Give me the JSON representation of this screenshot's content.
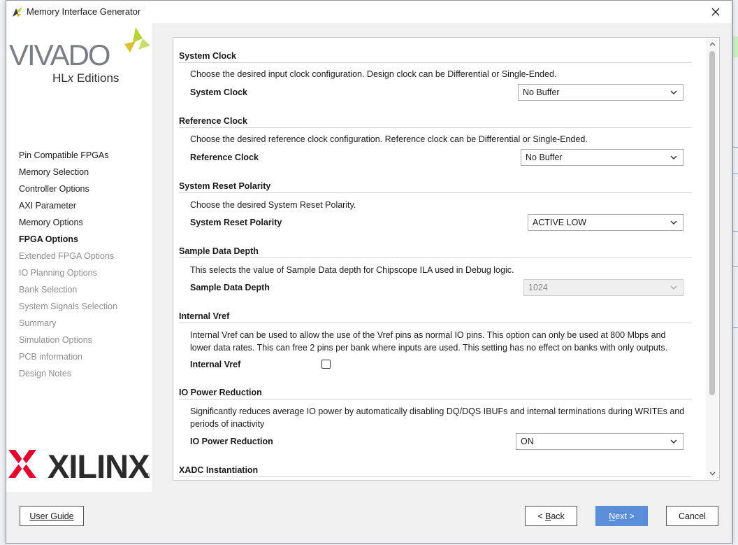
{
  "window": {
    "title": "Memory Interface Generator"
  },
  "branding": {
    "vivado": "VIVADO",
    "hlx_prefix": "HL",
    "hlx_x": "x",
    "hlx_suffix": " Editions",
    "xilinx": "XILINX",
    "reg": "®"
  },
  "nav": {
    "items": [
      {
        "label": "Pin Compatible FPGAs",
        "state": "normal"
      },
      {
        "label": "Memory Selection",
        "state": "normal"
      },
      {
        "label": "Controller Options",
        "state": "normal"
      },
      {
        "label": "AXI Parameter",
        "state": "normal"
      },
      {
        "label": "Memory Options",
        "state": "normal"
      },
      {
        "label": "FPGA Options",
        "state": "active"
      },
      {
        "label": "Extended FPGA Options",
        "state": "disabled"
      },
      {
        "label": "IO Planning Options",
        "state": "disabled"
      },
      {
        "label": "Bank Selection",
        "state": "disabled"
      },
      {
        "label": "System Signals Selection",
        "state": "disabled"
      },
      {
        "label": "Summary",
        "state": "disabled"
      },
      {
        "label": "Simulation Options",
        "state": "disabled"
      },
      {
        "label": "PCB information",
        "state": "disabled"
      },
      {
        "label": "Design Notes",
        "state": "disabled"
      }
    ]
  },
  "sections": {
    "system_clock": {
      "title": "System Clock",
      "desc": "Choose the desired input clock configuration. Design clock can be Differential or Single-Ended.",
      "label": "System Clock",
      "value": "No Buffer"
    },
    "reference_clock": {
      "title": "Reference Clock",
      "desc": "Choose the desired reference clock configuration. Reference clock can be Differential or Single-Ended.",
      "label": "Reference Clock",
      "value": "No Buffer"
    },
    "reset_polarity": {
      "title": "System Reset Polarity",
      "desc": "Choose the desired System Reset Polarity.",
      "label": "System Reset Polarity",
      "value": "ACTIVE LOW"
    },
    "sample_depth": {
      "title": "Sample Data Depth",
      "desc": "This selects the value of Sample Data depth for Chipscope ILA used in Debug logic.",
      "label": "Sample Data Depth",
      "value": "1024"
    },
    "internal_vref": {
      "title": "Internal Vref",
      "desc_line1": "Internal Vref can be used to allow the use of the Vref pins as normal IO pins. This option can only be used at 800 Mbps and",
      "desc_line2": "lower data rates. This can free 2 pins per bank where inputs are used. This setting has no effect on banks with only outputs.",
      "label": "Internal Vref",
      "checked": false
    },
    "io_power": {
      "title": "IO Power Reduction",
      "desc_line1": "Significantly reduces average IO power by automatically disabling DQ/DQS IBUFs and internal terminations during WRITEs and",
      "desc_line2": "periods of inactivity",
      "label": "IO Power Reduction",
      "value": "ON"
    },
    "xadc": {
      "title": "XADC Instantiation"
    }
  },
  "footer": {
    "user_guide": "User Guide",
    "back_prefix": "< ",
    "back_mnemonic": "B",
    "back_rest": "ack",
    "next_mnemonic": "N",
    "next_rest": "ext >",
    "cancel": "Cancel"
  },
  "colors": {
    "primary_button": "#5b8ed9",
    "vivado_leaf_green": "#b5d334",
    "xilinx_red": "#e4002b"
  }
}
